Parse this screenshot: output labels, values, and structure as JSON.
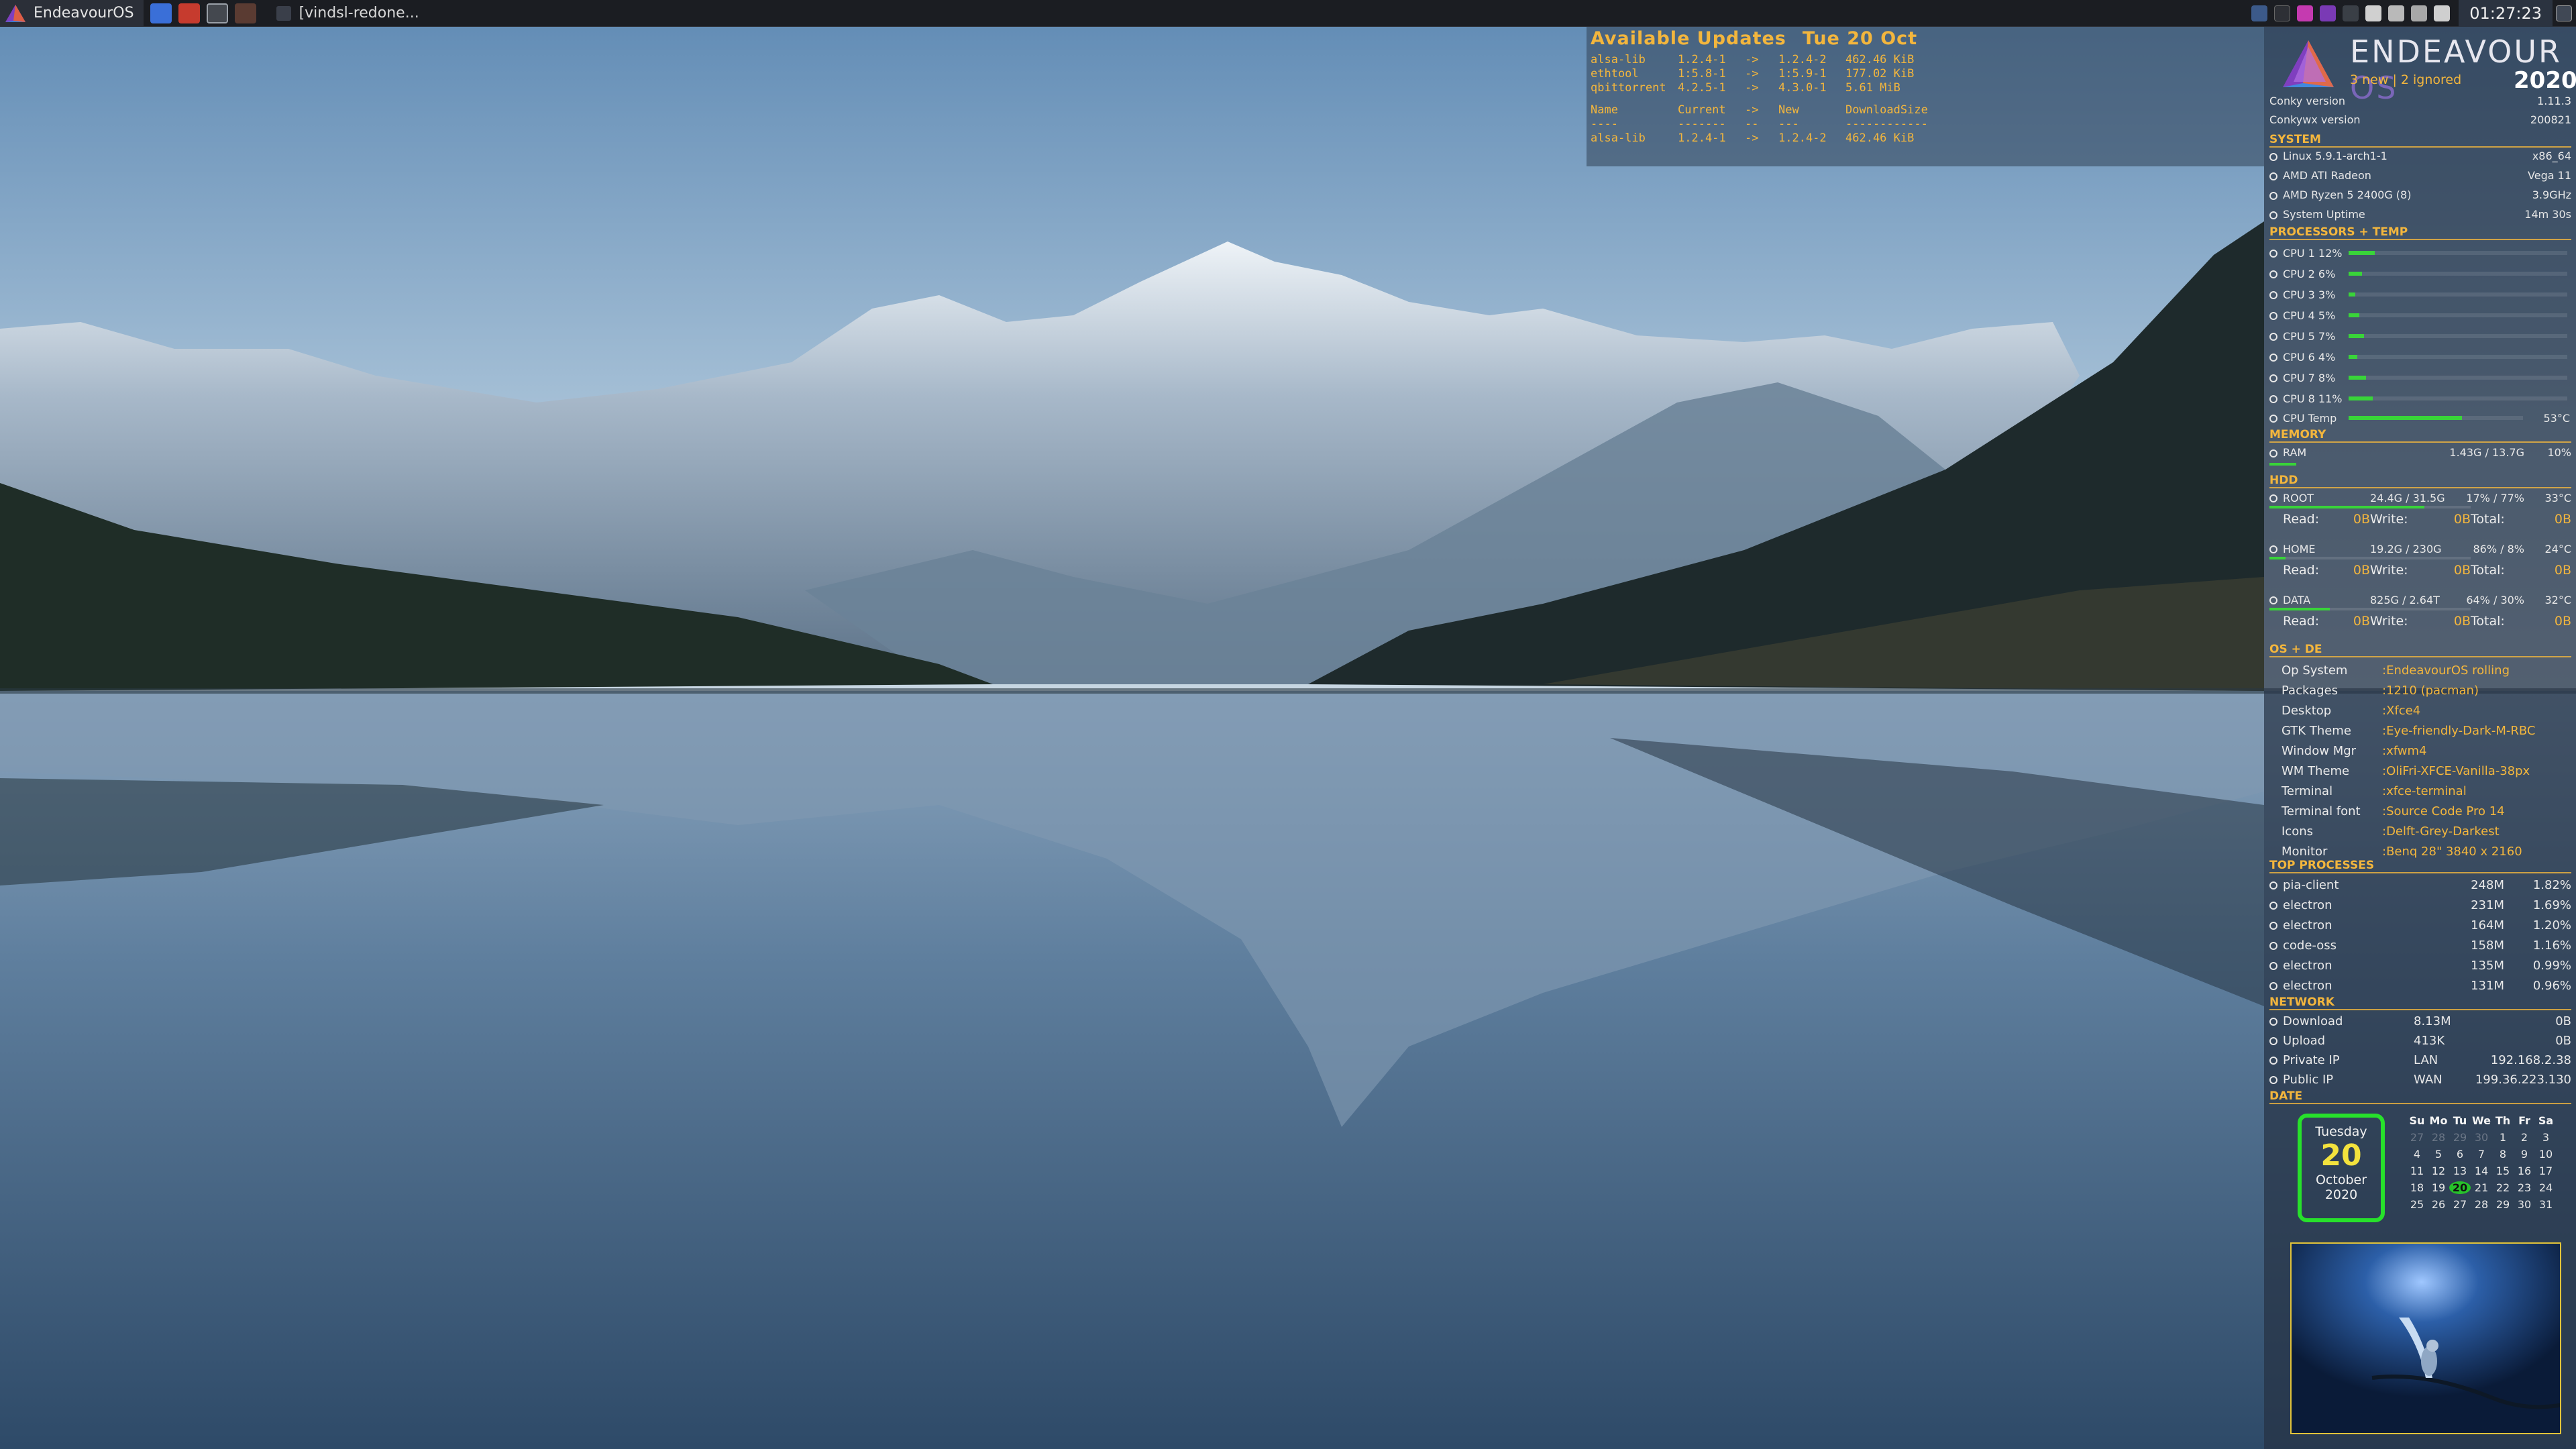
{
  "panel": {
    "menu_label": "EndeavourOS",
    "task_label": "[vindsl-redone...",
    "clock": "01:27:23"
  },
  "updates": {
    "title": "Available Updates",
    "date": "Tue 20 Oct",
    "rows": [
      [
        "alsa-lib",
        "1.2.4-1",
        "->",
        "1.2.4-2",
        "462.46 KiB"
      ],
      [
        "ethtool",
        "1:5.8-1",
        "->",
        "1:5.9-1",
        "177.02 KiB"
      ],
      [
        "qbittorrent",
        "4.2.5-1",
        "->",
        "4.3.0-1",
        "5.61 MiB"
      ]
    ],
    "header": [
      "Name",
      "Current",
      "->",
      "New",
      "DownloadSize"
    ],
    "separator": [
      "----",
      "-------",
      "--",
      "---",
      "------------"
    ],
    "detail": [
      "alsa-lib",
      "1.2.4-1",
      "->",
      "1.2.4-2",
      "462.46 KiB"
    ]
  },
  "conky": {
    "brand_name": "ENDEAVOUR",
    "brand_os": "OS",
    "brand_sub": "3 new | 2 ignored",
    "brand_year": "2020",
    "conky_version_label": "Conky version",
    "conky_version": "1.11.3",
    "conkywx_label": "Conkywx version",
    "conkywx_version": "200821",
    "system_title": "SYSTEM",
    "kernel": "Linux 5.9.1-arch1-1",
    "arch": "x86_64",
    "gpu": "AMD ATI Radeon",
    "gpu_model": "Vega 11",
    "cpu_name": "AMD Ryzen 5 2400G (8)",
    "cpu_freq": "3.9GHz",
    "uptime_label": "System Uptime",
    "uptime": "14m 30s",
    "proc_title": "PROCESSORS + TEMP",
    "cpus": [
      {
        "label": "CPU 1 12%",
        "pct": 12
      },
      {
        "label": "CPU 2 6%",
        "pct": 6
      },
      {
        "label": "CPU 3 3%",
        "pct": 3
      },
      {
        "label": "CPU 4 5%",
        "pct": 5
      },
      {
        "label": "CPU 5 7%",
        "pct": 7
      },
      {
        "label": "CPU 6 4%",
        "pct": 4
      },
      {
        "label": "CPU 7 8%",
        "pct": 8
      },
      {
        "label": "CPU 8 11%",
        "pct": 11
      }
    ],
    "cpu_temp_label": "CPU Temp",
    "cpu_temp": "53°C",
    "cpu_temp_pct": 65,
    "mem_title": "MEMORY",
    "ram_label": "RAM",
    "ram_value": "1.43G  / 13.7G",
    "ram_pct": "10%",
    "ram_pct_num": 10,
    "hdd_title": "HDD",
    "disks": [
      {
        "name": "ROOT",
        "size": "24.4G / 31.5G",
        "usage": "17% / 77%",
        "temp": "33°C",
        "pct": 77
      },
      {
        "name": "HOME",
        "size": "19.2G / 230G",
        "usage": "86% / 8%",
        "temp": "24°C",
        "pct": 8
      },
      {
        "name": "DATA",
        "size": "825G  / 2.64T",
        "usage": "64% / 30%",
        "temp": "32°C",
        "pct": 30
      }
    ],
    "io": {
      "read": "Read:",
      "write": "Write:",
      "total": "Total:",
      "zero": "0B"
    },
    "os_title": "OS + DE",
    "os": [
      [
        "Op System",
        ":EndeavourOS rolling"
      ],
      [
        "Packages",
        ":1210 (pacman)"
      ],
      [
        "Desktop",
        ":Xfce4"
      ],
      [
        "GTK Theme",
        ":Eye-friendly-Dark-M-RBC"
      ],
      [
        "Window Mgr",
        ":xfwm4"
      ],
      [
        "WM Theme",
        ":OliFri-XFCE-Vanilla-38px"
      ],
      [
        "Terminal",
        ":xfce-terminal"
      ],
      [
        "Terminal font",
        ":Source Code Pro 14"
      ],
      [
        "Icons",
        ":Delft-Grey-Darkest"
      ],
      [
        "Monitor",
        ":Benq 28\" 3840 x 2160"
      ]
    ],
    "top_title": "TOP PROCESSES",
    "top": [
      [
        "pia-client",
        "248M",
        "1.82%"
      ],
      [
        "electron",
        "231M",
        "1.69%"
      ],
      [
        "electron",
        "164M",
        "1.20%"
      ],
      [
        "code-oss",
        "158M",
        "1.16%"
      ],
      [
        "electron",
        "135M",
        "0.99%"
      ],
      [
        "electron",
        "131M",
        "0.96%"
      ]
    ],
    "net_title": "NETWORK",
    "net": [
      [
        "Download",
        "8.13M",
        "0B"
      ],
      [
        "Upload",
        "413K",
        "0B"
      ],
      [
        "Private IP",
        "LAN",
        "192.168.2.38"
      ],
      [
        "Public IP",
        "WAN",
        "199.36.223.130"
      ]
    ],
    "date_title": "DATE",
    "date": {
      "weekday": "Tuesday",
      "day": "20",
      "month": "October",
      "year": "2020"
    },
    "cal_head": [
      "Su",
      "Mo",
      "Tu",
      "We",
      "Th",
      "Fr",
      "Sa"
    ],
    "cal_weeks": [
      [
        "27",
        "28",
        "29",
        "30",
        "1",
        "2",
        "3"
      ],
      [
        "4",
        "5",
        "6",
        "7",
        "8",
        "9",
        "10"
      ],
      [
        "11",
        "12",
        "13",
        "14",
        "15",
        "16",
        "17"
      ],
      [
        "18",
        "19",
        "20",
        "21",
        "22",
        "23",
        "24"
      ],
      [
        "25",
        "26",
        "27",
        "28",
        "29",
        "30",
        "31"
      ]
    ]
  }
}
